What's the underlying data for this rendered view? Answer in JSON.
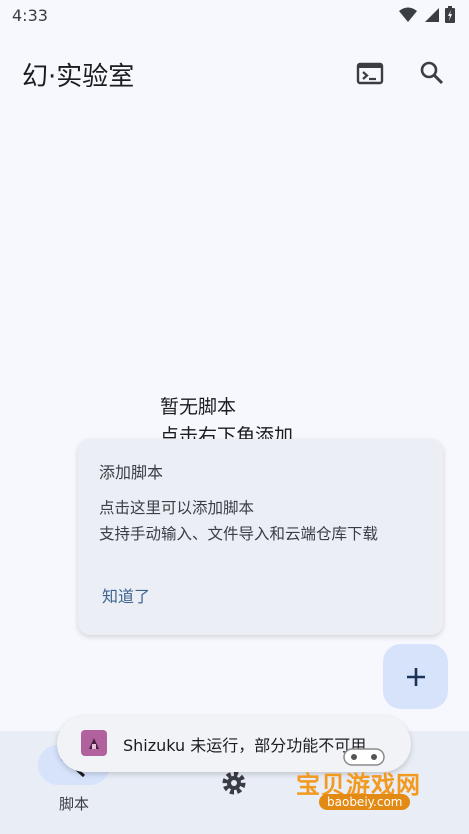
{
  "status_bar": {
    "time": "4:33"
  },
  "app_bar": {
    "title": "幻·实验室",
    "terminal_icon": "terminal-icon",
    "search_icon": "search-icon"
  },
  "empty_state": {
    "line1": "暂无脚本",
    "line2": "点击右下角添加"
  },
  "tip_card": {
    "title": "添加脚本",
    "body_line1": "点击这里可以添加脚本",
    "body_line2": "支持手动输入、文件导入和云端仓库下载",
    "action": "知道了"
  },
  "fab": {
    "icon": "plus-icon"
  },
  "bottom_nav": {
    "items": [
      {
        "label": "脚本",
        "icon": "script-icon",
        "selected": true
      },
      {
        "label": "",
        "icon": "settings-icon",
        "selected": false
      }
    ]
  },
  "snackbar": {
    "text": "Shizuku 未运行，部分功能不可用"
  },
  "watermark": {
    "text": "宝贝游戏网",
    "url": "baobeiy.com"
  },
  "colors": {
    "accent": "#3d6590",
    "fab_bg": "#d6e3fb",
    "card_bg": "#ebeef5",
    "snack_icon": "#b2619f"
  }
}
